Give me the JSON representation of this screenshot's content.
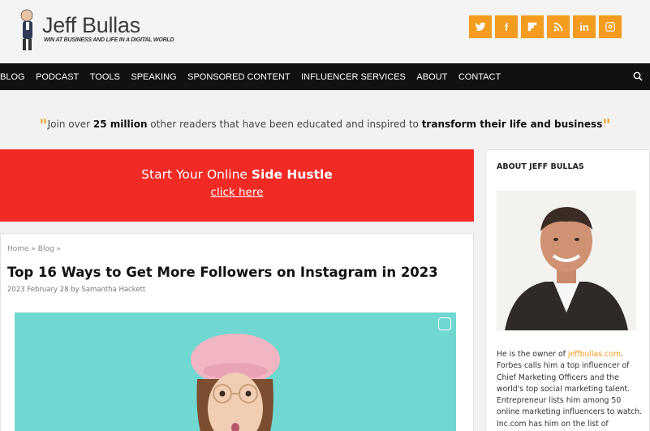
{
  "header": {
    "logo_title": "Jeff Bullas",
    "logo_tagline": "WIN AT BUSINESS AND LIFE IN A DIGITAL WORLD",
    "social": [
      {
        "icon": "twitter-icon",
        "glyph": ""
      },
      {
        "icon": "facebook-icon",
        "glyph": "f"
      },
      {
        "icon": "flipboard-icon",
        "glyph": ""
      },
      {
        "icon": "rss-icon",
        "glyph": ""
      },
      {
        "icon": "linkedin-icon",
        "glyph": "in"
      },
      {
        "icon": "instagram-icon",
        "glyph": ""
      }
    ],
    "accent_color": "#f39c1f"
  },
  "nav": {
    "items": [
      "BLOG",
      "PODCAST",
      "TOOLS",
      "SPEAKING",
      "SPONSORED CONTENT",
      "INFLUENCER SERVICES",
      "ABOUT",
      "CONTACT"
    ]
  },
  "tagline": {
    "open_quote": "\"",
    "pre": "Join over ",
    "bold1": "25 million",
    "mid": " other readers that have been educated and inspired to ",
    "bold2": "transform their life and business",
    "close_quote": "\""
  },
  "banner": {
    "pre": "Start Your Online ",
    "bold": "Side Hustle",
    "link": "click here",
    "color": "#f12a25"
  },
  "article": {
    "breadcrumb": "Home » Blog »",
    "title": "Top 16 Ways to Get More Followers on Instagram in 2023",
    "meta": "2023 February 28 by Samantha Hackett"
  },
  "sidebar": {
    "title": "ABOUT JEFF BULLAS",
    "bio_pre": "He is the owner of ",
    "bio_link": "jeffbullas.com",
    "bio_rest": ". Forbes calls him a top influencer of Chief Marketing Officers and the world's top social marketing talent. Entrepreneur lists him among 50 online marketing influencers to watch. Inc.com has him on the list of"
  }
}
